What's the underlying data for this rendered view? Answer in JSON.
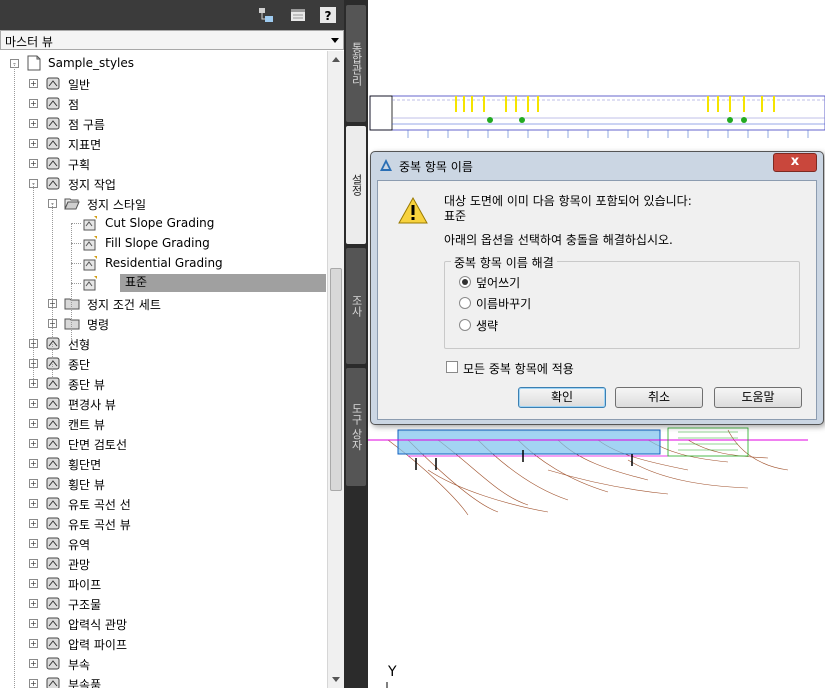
{
  "panel": {
    "view_selector": "마스터 뷰",
    "tree": [
      {
        "label": "Sample_styles",
        "level": 0,
        "expander": "-",
        "icon": "drawing-icon"
      },
      {
        "label": "일반",
        "level": 1,
        "expander": "+",
        "icon": "general-styles-icon"
      },
      {
        "label": "점",
        "level": 1,
        "expander": "+",
        "icon": "point-icon"
      },
      {
        "label": "점 구름",
        "level": 1,
        "expander": "+",
        "icon": "point-cloud-icon"
      },
      {
        "label": "지표면",
        "level": 1,
        "expander": "+",
        "icon": "surface-icon"
      },
      {
        "label": "구획",
        "level": 1,
        "expander": "+",
        "icon": "parcel-icon"
      },
      {
        "label": "정지 작업",
        "level": 1,
        "expander": "-",
        "icon": "grading-icon"
      },
      {
        "label": "정지 스타일",
        "level": 2,
        "expander": "-",
        "icon": "folder-open-icon"
      },
      {
        "label": "Cut Slope Grading",
        "level": 3,
        "expander": "",
        "icon": "style-icon"
      },
      {
        "label": "Fill Slope Grading",
        "level": 3,
        "expander": "",
        "icon": "style-icon"
      },
      {
        "label": "Residential Grading",
        "level": 3,
        "expander": "",
        "icon": "style-icon"
      },
      {
        "label": "표준",
        "level": 3,
        "expander": "",
        "icon": "style-icon",
        "selected": true
      },
      {
        "label": "정지 조건 세트",
        "level": 2,
        "expander": "+",
        "icon": "folder-icon"
      },
      {
        "label": "명령",
        "level": 2,
        "expander": "+",
        "icon": "folder-icon"
      },
      {
        "label": "선형",
        "level": 1,
        "expander": "+",
        "icon": "alignment-icon"
      },
      {
        "label": "종단",
        "level": 1,
        "expander": "+",
        "icon": "profile-icon"
      },
      {
        "label": "종단 뷰",
        "level": 1,
        "expander": "+",
        "icon": "profile-view-icon"
      },
      {
        "label": "편경사 뷰",
        "level": 1,
        "expander": "+",
        "icon": "superelevation-view-icon"
      },
      {
        "label": "캔트 뷰",
        "level": 1,
        "expander": "+",
        "icon": "cant-view-icon"
      },
      {
        "label": "단면 검토선",
        "level": 1,
        "expander": "+",
        "icon": "sample-line-icon"
      },
      {
        "label": "횡단면",
        "level": 1,
        "expander": "+",
        "icon": "section-icon"
      },
      {
        "label": "횡단 뷰",
        "level": 1,
        "expander": "+",
        "icon": "section-view-icon"
      },
      {
        "label": "유토 곡선 선",
        "level": 1,
        "expander": "+",
        "icon": "mass-haul-line-icon"
      },
      {
        "label": "유토 곡선 뷰",
        "level": 1,
        "expander": "+",
        "icon": "mass-haul-view-icon"
      },
      {
        "label": "유역",
        "level": 1,
        "expander": "+",
        "icon": "catchment-icon"
      },
      {
        "label": "관망",
        "level": 1,
        "expander": "+",
        "icon": "pipe-network-icon"
      },
      {
        "label": "파이프",
        "level": 1,
        "expander": "+",
        "icon": "pipe-icon"
      },
      {
        "label": "구조물",
        "level": 1,
        "expander": "+",
        "icon": "structure-icon"
      },
      {
        "label": "압력식 관망",
        "level": 1,
        "expander": "+",
        "icon": "pressure-network-icon"
      },
      {
        "label": "압력 파이프",
        "level": 1,
        "expander": "+",
        "icon": "pressure-pipe-icon"
      },
      {
        "label": "부속",
        "level": 1,
        "expander": "+",
        "icon": "fitting-icon"
      },
      {
        "label": "부속품",
        "level": 1,
        "expander": "+",
        "icon": "appurtenance-icon"
      }
    ]
  },
  "vtabs": [
    {
      "label": "통합관리",
      "active": false
    },
    {
      "label": "설정",
      "active": true
    },
    {
      "label": "조사",
      "active": false
    },
    {
      "label": "도구 상자",
      "active": false
    }
  ],
  "dialog": {
    "title": "중복 항목 이름",
    "close_label": "x",
    "message_line1": "대상 도면에 이미 다음 항목이 포함되어 있습니다:",
    "item_name": "표준",
    "instruction": "아래의 옵션을 선택하여 충돌을 해결하십시오.",
    "group_title": "중복 항목 이름 해결",
    "options": [
      {
        "label": "덮어쓰기",
        "selected": true
      },
      {
        "label": "이름바꾸기",
        "selected": false
      },
      {
        "label": "생략",
        "selected": false
      }
    ],
    "apply_all_label": "모든 중복 항목에 적용",
    "apply_all_checked": false,
    "buttons": {
      "ok": "확인",
      "cancel": "취소",
      "help": "도움말"
    }
  },
  "drawing": {
    "axis_label": "Y"
  },
  "colors": {
    "accent_yellow": "#f5e400",
    "contour_brown": "#a0522d",
    "hatch_blue": "#3aa0e0",
    "green": "#22aa22",
    "magenta": "#e000e0"
  }
}
